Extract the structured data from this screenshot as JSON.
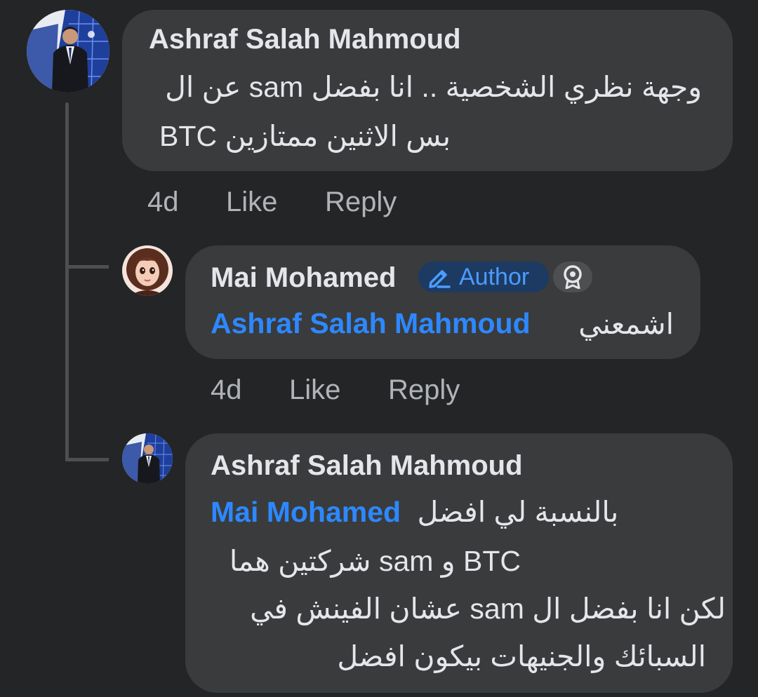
{
  "comments": [
    {
      "author": "Ashraf Salah Mahmoud",
      "lines": [
        "وجهة نظري الشخصية .. انا بفضل sam عن ال",
        "بس الاثنين ممتازين BTC"
      ],
      "time": "4d",
      "like_label": "Like",
      "reply_label": "Reply"
    },
    {
      "author": "Mai Mohamed",
      "badge_label": "Author",
      "mention": "Ashraf Salah Mahmoud",
      "text": "اشمعني",
      "time": "4d",
      "like_label": "Like",
      "reply_label": "Reply"
    },
    {
      "author": "Ashraf Salah Mahmoud",
      "mention": "Mai Mohamed",
      "text_after_mention": "بالنسبة لي افضل",
      "lines": [
        "BTC و sam شركتين هما",
        "لكن انا بفضل ال sam عشان الفينش في",
        "السبائك والجنيهات بيكون افضل"
      ]
    }
  ],
  "icons": {
    "author_badge_icon": "pencil-icon",
    "top_fan_icon": "award-icon"
  },
  "colors": {
    "background": "#242526",
    "bubble": "#3a3b3c",
    "mention": "#2d88ff",
    "secondary_text": "#b0b3b8"
  }
}
